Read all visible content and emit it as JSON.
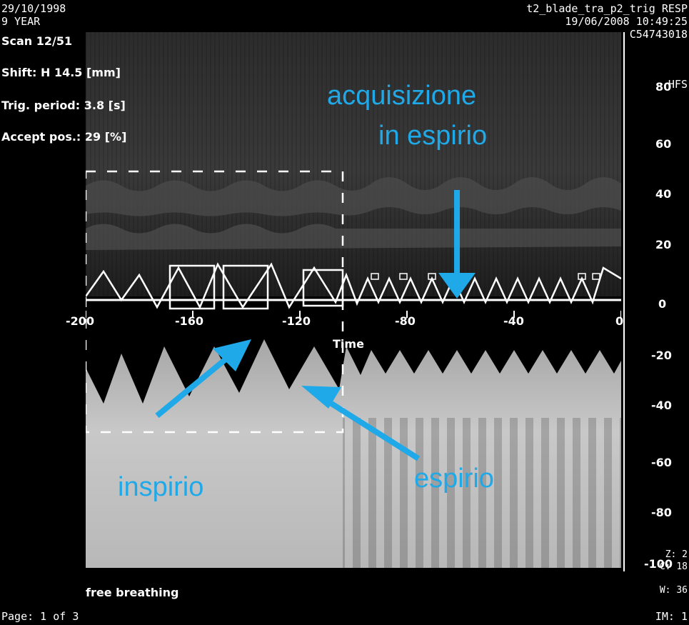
{
  "overlay": {
    "date_left": "29/10/1998",
    "age": "9 YEAR",
    "scan": "Scan 12/51",
    "shift": "Shift: H 14.5 [mm]",
    "trig_period": "Trig. period: 3.8 [s]",
    "accept_pos": "Accept pos.: 29 [%]",
    "protocol": "t2_blade_tra_p2_trig RESP",
    "date_right": "19/06/2008 10:49:25",
    "id": "C54743018",
    "orientation": "HFS",
    "view": "Head first",
    "time_label": "Time",
    "mode": "free breathing",
    "page": "Page: 1 of 3",
    "image": "IM: 1",
    "zoom": "Z: 2",
    "center": "C: 18",
    "width": "W: 36"
  },
  "x_ticks": [
    "-200",
    "-160",
    "-120",
    "-80",
    "-40",
    "0"
  ],
  "y_ticks": [
    "80",
    "60",
    "40",
    "20",
    "0",
    "-20",
    "-40",
    "-60",
    "-80",
    "-100"
  ],
  "annotations": {
    "exp_acq_line1": "acquisizione",
    "exp_acq_line2": "in espirio",
    "inspiration": "inspirio",
    "expiration": "espirio"
  },
  "colors": {
    "annotation": "#1fa9e8",
    "trace": "#ffffff"
  }
}
